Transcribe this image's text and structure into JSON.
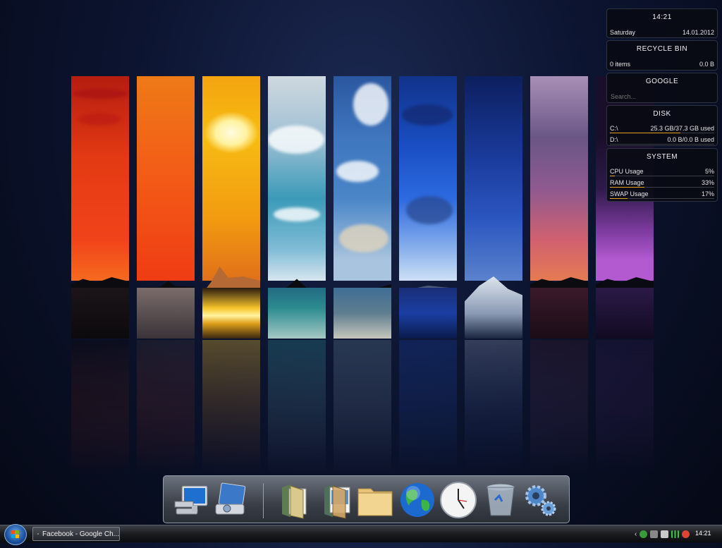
{
  "gadgets": {
    "clock": {
      "time": "14:21",
      "day": "Saturday",
      "date": "14.01.2012"
    },
    "recycle_bin": {
      "title": "RECYCLE BIN",
      "items": "0 items",
      "size": "0.0 B"
    },
    "google": {
      "title": "GOOGLE",
      "placeholder": "Search..."
    },
    "disk": {
      "title": "DISK",
      "drives": [
        {
          "label": "C:\\",
          "usage": "25.3 GB/37.3 GB used",
          "fraction": 0.678
        },
        {
          "label": "D:\\",
          "usage": "0.0 B/0.0 B used",
          "fraction": 0
        }
      ]
    },
    "system": {
      "title": "SYSTEM",
      "metrics": [
        {
          "label": "CPU Usage",
          "value": "5%",
          "fraction": 0.05
        },
        {
          "label": "RAM Usage",
          "value": "33%",
          "fraction": 0.33
        },
        {
          "label": "SWAP Usage",
          "value": "17%",
          "fraction": 0.17
        }
      ]
    }
  },
  "dock": {
    "icons": [
      "computer-icon",
      "control-panel-icon",
      "documents-folder-icon",
      "pictures-folder-icon",
      "folder-icon",
      "globe-icon",
      "clock-icon",
      "recycle-bin-icon",
      "settings-gears-icon"
    ]
  },
  "taskbar": {
    "task_label": "Facebook - Google Ch...",
    "clock": "14:21",
    "tray_icons": [
      "chevron-left-icon",
      "utorrent-icon",
      "security-icon",
      "network-icon",
      "signal-bars-icon",
      "antivirus-icon"
    ]
  },
  "colors": {
    "accent_bar": "#e4a11b",
    "gadget_bg": "#080a12"
  }
}
